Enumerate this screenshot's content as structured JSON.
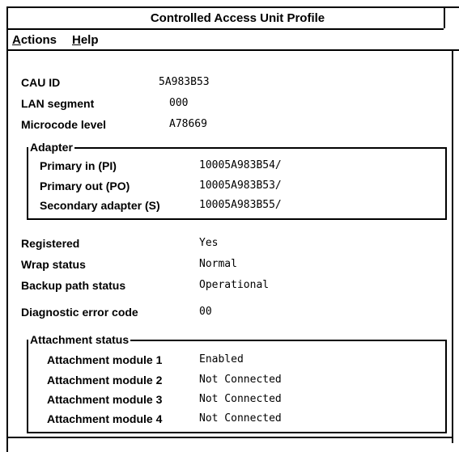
{
  "window": {
    "title": "Controlled Access Unit Profile"
  },
  "menubar": [
    {
      "label_hot": "A",
      "label_rest": "ctions"
    },
    {
      "label_hot": "H",
      "label_rest": "elp"
    }
  ],
  "info": {
    "cau_id": {
      "label": "CAU ID",
      "value": "5A983B53"
    },
    "lan_segment": {
      "label": "LAN segment",
      "value": "000"
    },
    "microcode_level": {
      "label": "Microcode level",
      "value": "A78669"
    }
  },
  "adapter": {
    "legend": "Adapter",
    "rows": [
      {
        "label": "Primary in (PI)",
        "value": "10005A983B54/"
      },
      {
        "label": "Primary out (PO)",
        "value": "10005A983B53/"
      },
      {
        "label": "Secondary adapter (S)",
        "value": "10005A983B55/"
      }
    ]
  },
  "status": {
    "registered": {
      "label": "Registered",
      "value": "Yes"
    },
    "wrap_status": {
      "label": "Wrap status",
      "value": "Normal"
    },
    "backup_path_status": {
      "label": "Backup path status",
      "value": "Operational"
    },
    "diagnostic_error_code": {
      "label": "Diagnostic error code",
      "value": "00"
    }
  },
  "attachment": {
    "legend": "Attachment status",
    "rows": [
      {
        "label": "Attachment module 1",
        "value": "Enabled"
      },
      {
        "label": "Attachment module 2",
        "value": "Not Connected"
      },
      {
        "label": "Attachment module 3",
        "value": "Not Connected"
      },
      {
        "label": "Attachment module 4",
        "value": "Not Connected"
      }
    ]
  }
}
